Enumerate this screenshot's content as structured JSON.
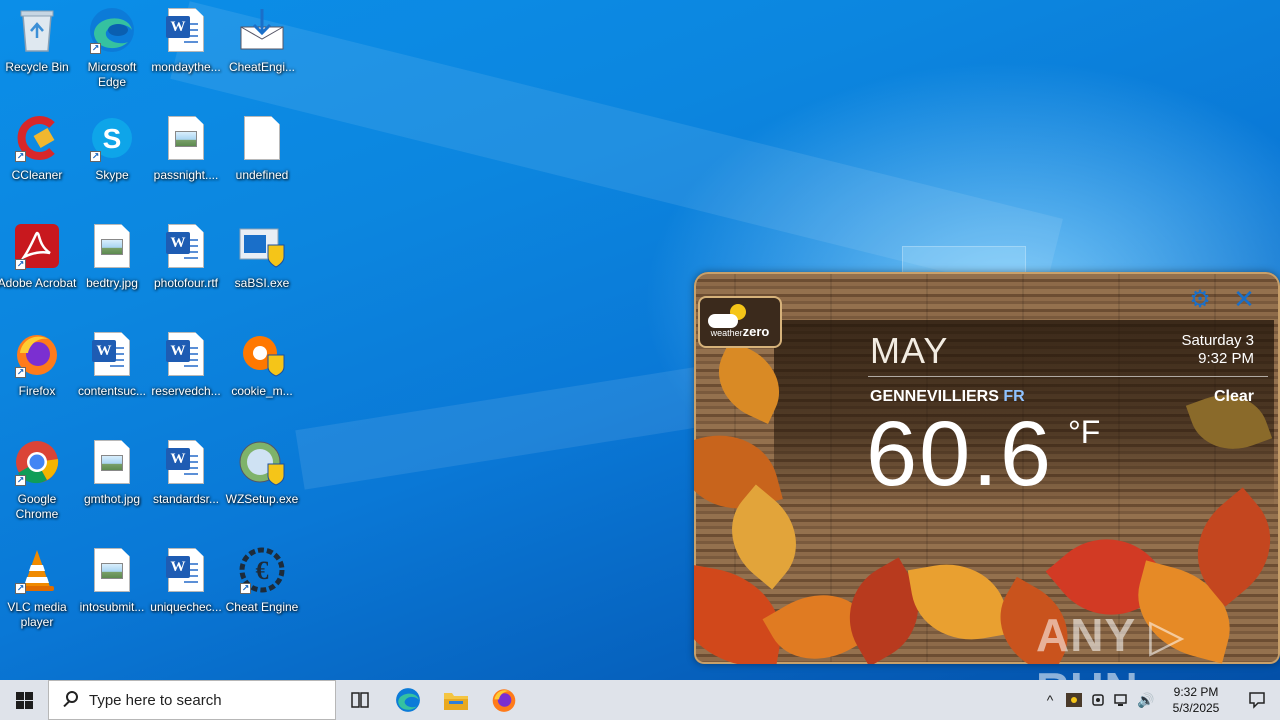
{
  "desktop": {
    "icons": [
      {
        "label": "Recycle Bin"
      },
      {
        "label": "Microsoft Edge"
      },
      {
        "label": "mondaythe..."
      },
      {
        "label": "CheatEngi..."
      },
      {
        "label": "CCleaner"
      },
      {
        "label": "Skype"
      },
      {
        "label": "passnight...."
      },
      {
        "label": "undefined"
      },
      {
        "label": "Adobe Acrobat"
      },
      {
        "label": "bedtry.jpg"
      },
      {
        "label": "photofour.rtf"
      },
      {
        "label": "saBSI.exe"
      },
      {
        "label": "Firefox"
      },
      {
        "label": "contentsuc..."
      },
      {
        "label": "reservedch..."
      },
      {
        "label": "cookie_m..."
      },
      {
        "label": "Google Chrome"
      },
      {
        "label": "gmthot.jpg"
      },
      {
        "label": "standardsr..."
      },
      {
        "label": "WZSetup.exe"
      },
      {
        "label": "VLC media player"
      },
      {
        "label": "intosubmit..."
      },
      {
        "label": "uniquechec..."
      },
      {
        "label": "Cheat Engine"
      }
    ]
  },
  "weather": {
    "logo_text": "weather",
    "logo_text2": "zero",
    "month": "MAY",
    "day_label": "Saturday 3",
    "time_label": "9:32 PM",
    "city": "GENNEVILLIERS",
    "country": "FR",
    "condition": "Clear",
    "temperature": "60.6",
    "unit": "°F",
    "settings_glyph": "⚙",
    "close_glyph": "✕"
  },
  "watermark": "ANY ▷ RUN",
  "taskbar": {
    "search_placeholder": "Type here to search",
    "clock_time": "9:32 PM",
    "clock_date": "5/3/2025",
    "tray_chevron": "^",
    "volume_glyph": "🔊"
  },
  "colors": {
    "accent": "#1a6fc9",
    "taskbar_bg": "#dfe3ea"
  }
}
